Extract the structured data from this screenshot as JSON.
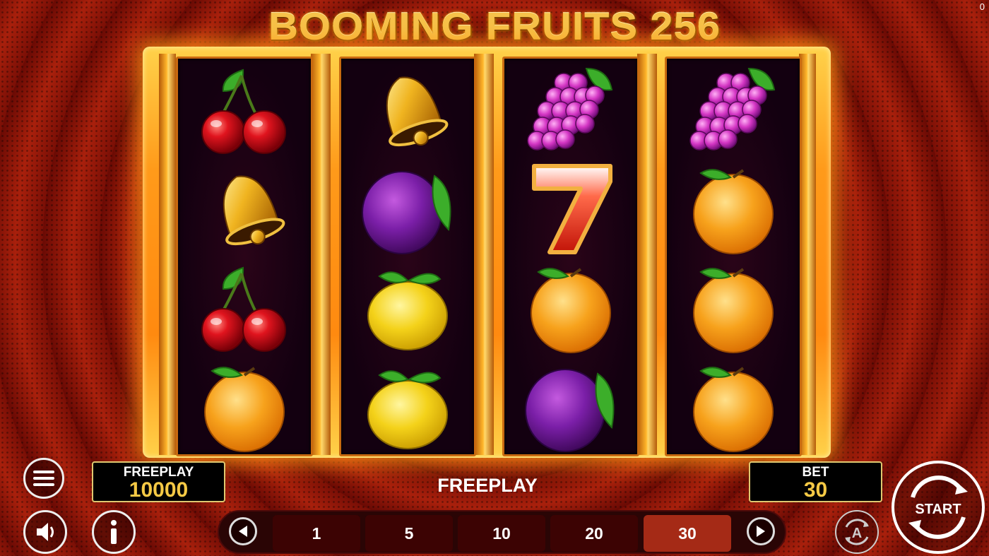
{
  "corner_counter": "0",
  "game_title": "BOOMING FRUITS 256",
  "reels": [
    [
      "cherry-icon",
      "bell-icon",
      "cherry-icon",
      "orange-icon"
    ],
    [
      "bell-icon",
      "plum-icon",
      "lemon-icon",
      "lemon-icon"
    ],
    [
      "grapes-icon",
      "seven-icon",
      "orange-icon",
      "plum-icon"
    ],
    [
      "grapes-icon",
      "orange-icon",
      "orange-icon",
      "orange-icon"
    ]
  ],
  "balance": {
    "label": "FREEPLAY",
    "value": "10000"
  },
  "status_message": "FREEPLAY",
  "bet": {
    "label": "BET",
    "value": "30"
  },
  "bet_options": [
    "1",
    "5",
    "10",
    "20",
    "30"
  ],
  "selected_bet": "30",
  "start_label": "START",
  "icons": {
    "menu": "menu-icon",
    "sound": "sound-icon",
    "info": "info-icon",
    "prev": "arrow-left-icon",
    "next": "arrow-right-icon",
    "autoplay": "autoplay-icon",
    "start": "spin-icon"
  },
  "colors": {
    "accent_gold": "#f5c945",
    "selected_bet_bg": "#a52a16",
    "frame_glow": "#ff9a1a"
  }
}
